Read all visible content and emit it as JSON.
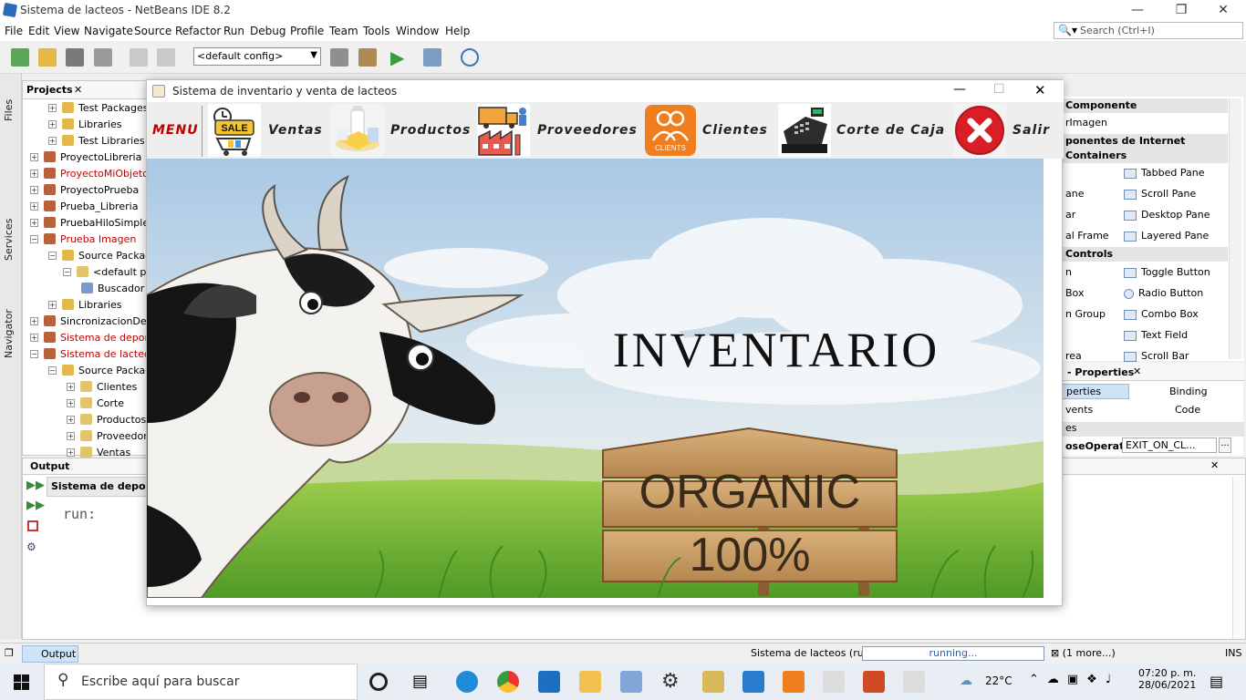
{
  "ide": {
    "title": "Sistema de lacteos - NetBeans IDE 8.2",
    "menu": [
      "File",
      "Edit",
      "View",
      "Navigate",
      "Source",
      "Refactor",
      "Run",
      "Debug",
      "Profile",
      "Team",
      "Tools",
      "Window",
      "Help"
    ],
    "search_placeholder": "Search (Ctrl+I)",
    "config": "<default config>"
  },
  "side_tabs": [
    "Files",
    "Services",
    "Navigator"
  ],
  "projects": {
    "title": "Projects",
    "items": [
      {
        "label": "Test Packages",
        "color": "#000"
      },
      {
        "label": "Libraries",
        "color": "#000"
      },
      {
        "label": "Test Libraries",
        "color": "#000"
      },
      {
        "label": "ProyectoLibreria",
        "color": "#000"
      },
      {
        "label": "ProyectoMiObjeto",
        "color": "#c00000"
      },
      {
        "label": "ProyectoPrueba",
        "color": "#000"
      },
      {
        "label": "Prueba_Libreria",
        "color": "#000"
      },
      {
        "label": "PruebaHiloSimple",
        "color": "#000"
      },
      {
        "label": "Prueba Imagen",
        "color": "#c00000"
      },
      {
        "label": "Source Packages",
        "color": "#000"
      },
      {
        "label": "<default package>",
        "color": "#000"
      },
      {
        "label": "Buscador",
        "color": "#000"
      },
      {
        "label": "Libraries",
        "color": "#000"
      },
      {
        "label": "SincronizacionDeHilos",
        "color": "#000"
      },
      {
        "label": "Sistema de deportes",
        "color": "#c00000"
      },
      {
        "label": "Sistema de lacteos",
        "color": "#c00000"
      },
      {
        "label": "Source Packages",
        "color": "#000"
      },
      {
        "label": "Clientes",
        "color": "#000"
      },
      {
        "label": "Corte",
        "color": "#000"
      },
      {
        "label": "Productos",
        "color": "#000"
      },
      {
        "label": "Proveedores",
        "color": "#000"
      },
      {
        "label": "Ventas",
        "color": "#000"
      }
    ]
  },
  "output": {
    "title": "Output",
    "tab": "Sistema de deportes",
    "text": "run:"
  },
  "palette": {
    "cat1": "Componente",
    "item1": "rImagen",
    "cat2": "ponentes de Internet",
    "cat3": "Containers",
    "left": [
      "ane",
      "ar",
      "al Frame"
    ],
    "right": [
      "Tabbed Pane",
      "Scroll Pane",
      "Desktop Pane",
      "Layered Pane"
    ],
    "cat4": "Controls",
    "left2": [
      "n",
      "Box",
      "n Group",
      "rea"
    ],
    "right2": [
      "Toggle Button",
      "Radio Button",
      "Combo Box",
      "Text Field",
      "Scroll Bar"
    ]
  },
  "properties": {
    "title": "- Properties",
    "tab1": "perties",
    "tab2": "Binding",
    "tab3": "vents",
    "tab4": "Code",
    "section": "es",
    "prop": "oseOperatic",
    "value": "EXIT_ON_CL..."
  },
  "status": {
    "output_tab": "Output",
    "run_label": "Sistema de lacteos (run)",
    "progress": "running...",
    "more": "(1 more...)",
    "mode": "INS"
  },
  "taskbar": {
    "search": "Escribe aquí para buscar",
    "temp": "22°C",
    "time": "07:20 p. m.",
    "date": "28/06/2021"
  },
  "app": {
    "title": "Sistema de inventario y venta de lacteos",
    "menu_label": "MENU",
    "items": [
      {
        "label": "Ventas",
        "icon": "sale-cart-icon"
      },
      {
        "label": "Productos",
        "icon": "dairy-products-icon"
      },
      {
        "label": "Proveedores",
        "icon": "supplier-truck-icon"
      },
      {
        "label": "Clientes",
        "icon": "clients-icon"
      },
      {
        "label": "Corte de Caja",
        "icon": "cash-register-icon"
      },
      {
        "label": "Salir",
        "icon": "exit-icon"
      }
    ],
    "sale_text": "SALE",
    "clients_text": "CLIENTS",
    "headline": "INVENTARIO",
    "sign_line1": "ORGANIC",
    "sign_line2": "100%"
  }
}
